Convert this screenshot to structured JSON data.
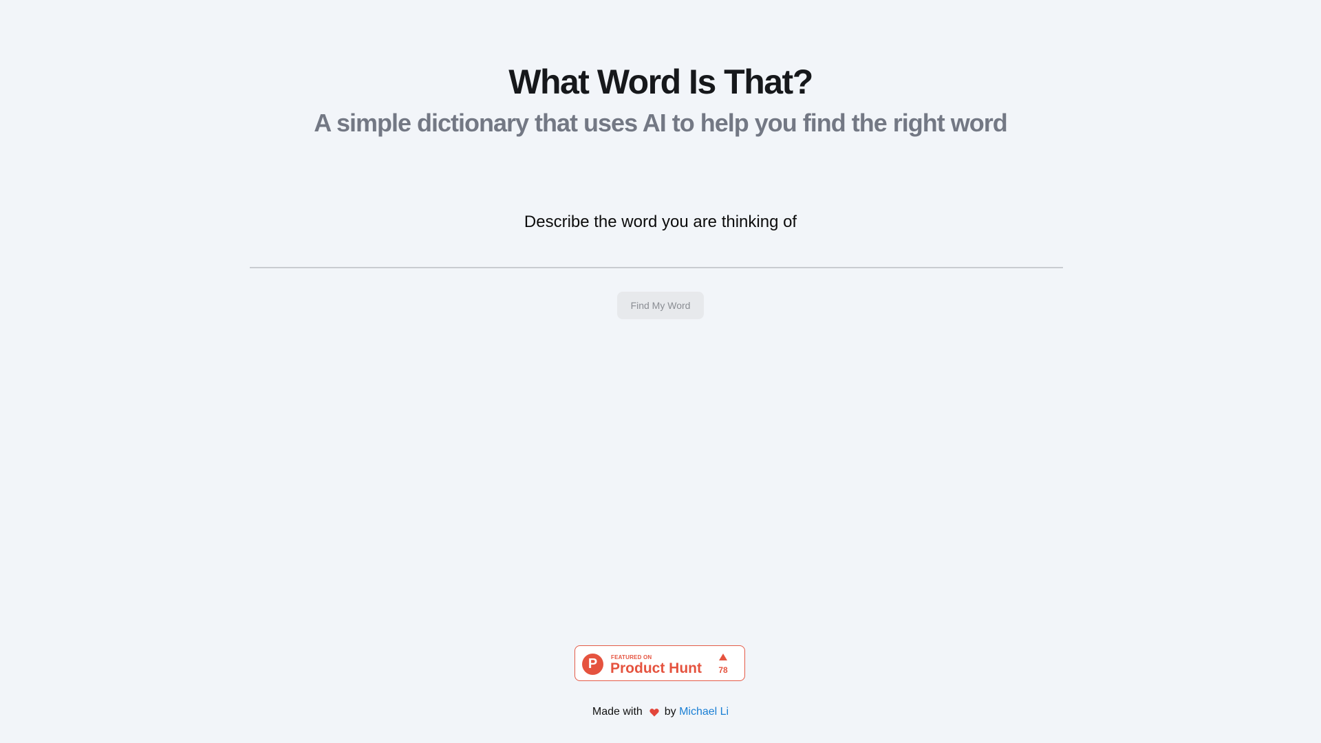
{
  "header": {
    "title": "What Word Is That?",
    "subtitle": "A simple dictionary that uses AI to help you find the right word"
  },
  "search": {
    "label": "Describe the word you are thinking of",
    "value": "",
    "placeholder": ""
  },
  "actions": {
    "find_label": "Find My Word"
  },
  "product_hunt": {
    "featured_text": "FEATURED ON",
    "name": "Product Hunt",
    "logo_letter": "P",
    "upvotes": "78",
    "color": "#e5533f"
  },
  "footer": {
    "made_with": "Made with",
    "heart_icon": "heart-icon",
    "by": "by",
    "author": "Michael Li",
    "link_color": "#1a7fd4"
  }
}
